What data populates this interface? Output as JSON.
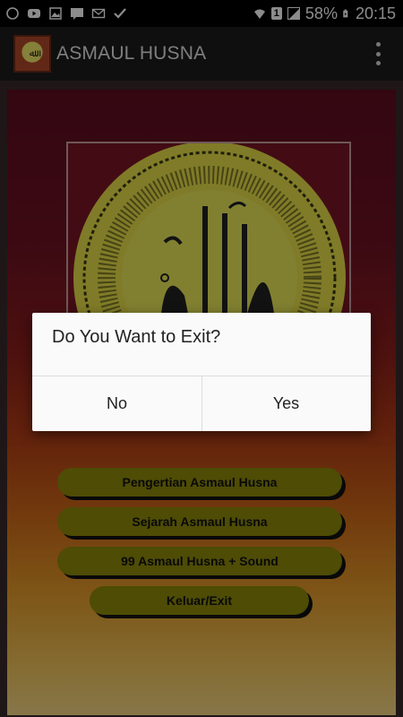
{
  "status_bar": {
    "battery_percent": "58%",
    "time": "20:15",
    "sim_badge": "1"
  },
  "app_bar": {
    "title": "ASMAUL HUSNA",
    "logo_text": "ﷲ"
  },
  "menu": {
    "buttons": [
      "Pengertian Asmaul Husna",
      "Sejarah Asmaul Husna",
      "99 Asmaul Husna + Sound",
      "Keluar/Exit"
    ]
  },
  "dialog": {
    "title": "Do You Want to Exit?",
    "negative_label": "No",
    "positive_label": "Yes"
  },
  "colors": {
    "button_fill": "#8e8a0a",
    "panel_top": "#5e0d20",
    "panel_bottom": "#f6d887",
    "dialog_bg": "#fafafa"
  }
}
